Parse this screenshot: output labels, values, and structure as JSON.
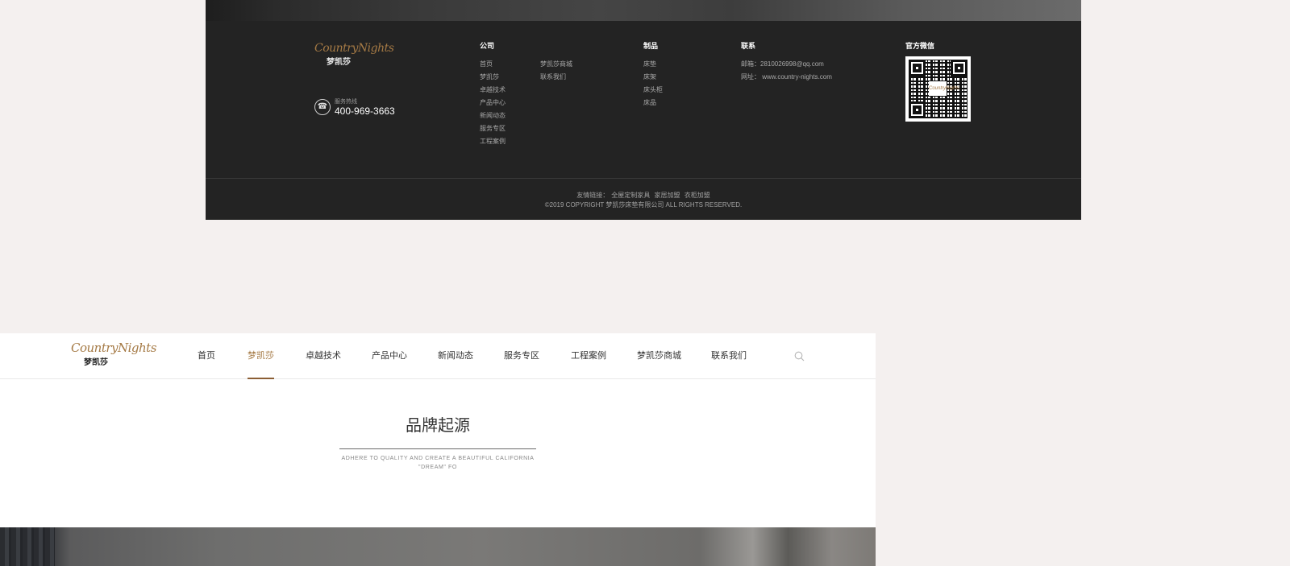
{
  "footer": {
    "logo": {
      "script_text": "CountryNights",
      "cn_text": "梦凯莎"
    },
    "hotline": {
      "label": "服务热线",
      "number": "400-969-3663"
    },
    "company": {
      "title": "公司",
      "col1": [
        "首页",
        "梦凯莎",
        "卓越技术",
        "产品中心",
        "新闻动态",
        "服务专区",
        "工程案例"
      ],
      "col2": [
        "梦凯莎商城",
        "联系我们"
      ]
    },
    "products": {
      "title": "制品",
      "items": [
        "床垫",
        "床架",
        "床头柜",
        "床品"
      ]
    },
    "contact": {
      "title": "联系",
      "email": "邮箱：2810026998@qq.com",
      "website": "网址： www.country-nights.com"
    },
    "wechat": {
      "title": "官方微信",
      "qr_logo_text": "CountryNights"
    },
    "friend_links": {
      "label": "友情链接：",
      "links": [
        "全屋定制家具",
        "家居加盟",
        "衣柜加盟"
      ]
    },
    "copyright": "©2019 COPYRIGHT 梦凯莎床垫有限公司 ALL RIGHTS RESERVED."
  },
  "nav": {
    "logo": {
      "script_text": "CountryNights",
      "cn_text": "梦凯莎"
    },
    "items": [
      "首页",
      "梦凯莎",
      "卓越技术",
      "产品中心",
      "新闻动态",
      "服务专区",
      "工程案例",
      "梦凯莎商城",
      "联系我们"
    ],
    "active_index": 1
  },
  "brand": {
    "title": "品牌起源",
    "subtitle": "ADHERE TO QUALITY AND CREATE A BEAUTIFUL CALIFORNIA \"DREAM\" FO"
  },
  "colors": {
    "page_bg": "#f4f0ef",
    "footer_bg": "#232323",
    "accent": "#a57a45",
    "active_underline": "#8b5e34"
  }
}
